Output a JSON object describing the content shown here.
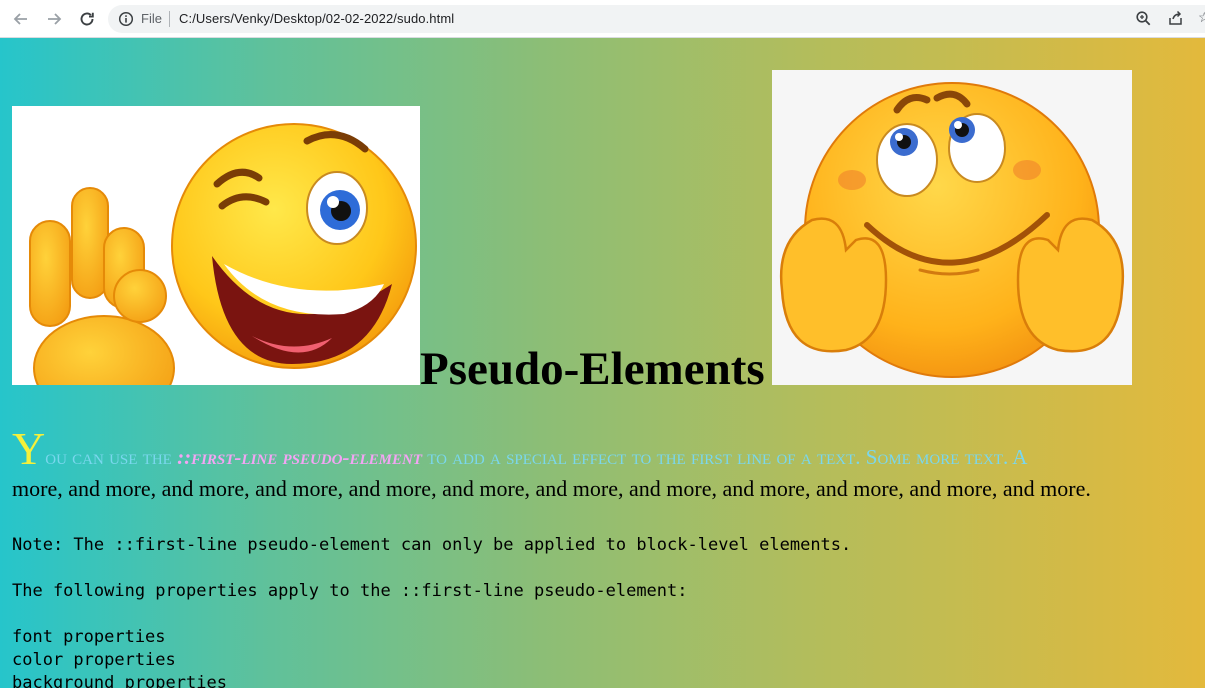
{
  "browser": {
    "scheme_label": "File",
    "url": "C:/Users/Venky/Desktop/02-02-2022/sudo.html"
  },
  "page": {
    "title": "Pseudo-Elements",
    "paragraph": {
      "drop_letter": "Y",
      "first_line_a": "ou can use the ",
      "first_line_code": "::first-line pseudo-element",
      "first_line_b": " to add a special effect to the first line of a text. Some more text. A",
      "second_line": "more, and more, and more, and more, and more, and more, and more, and more, and more, and more, and more, and more."
    },
    "note": "Note: The ::first-line pseudo-element can only be applied to block-level elements.",
    "following": "The following properties apply to the ::first-line pseudo-element:",
    "properties": [
      "font properties",
      "color properties",
      "background properties"
    ]
  },
  "colors": {
    "gradient_left": "#26c5cb",
    "gradient_right": "#e3b93c",
    "first_line_text": "#7ad7ee",
    "drop_letter": "#f5f03a",
    "code_highlight": "#f3a4f4"
  },
  "images": [
    "wink-emoji-ok-hand",
    "dreamy-emoji-hands-on-cheeks"
  ]
}
